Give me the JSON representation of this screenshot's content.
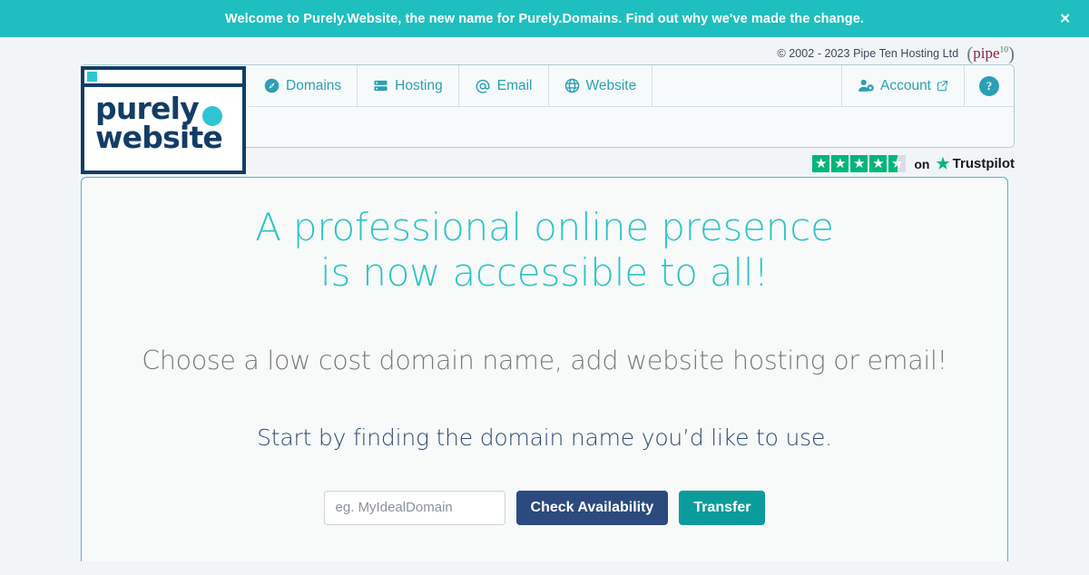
{
  "banner": {
    "message": "Welcome to Purely.Website, the new name for Purely.Domains. Find out why we've made the change.",
    "close_label": "✕",
    "bg_color": "#1fbfbf"
  },
  "copyright": {
    "text": "© 2002 - 2023 Pipe Ten Hosting Ltd",
    "logo_open_paren": "(",
    "logo_word": "pipe",
    "logo_superscript": "10",
    "logo_close_paren": ")"
  },
  "logo": {
    "line1": "purely",
    "line2": "website",
    "color": "#123d66",
    "accent_color": "#2ec4d4"
  },
  "nav": {
    "items": [
      {
        "label": "Domains",
        "icon": "compass-icon"
      },
      {
        "label": "Hosting",
        "icon": "server-icon"
      },
      {
        "label": "Email",
        "icon": "at-sign-icon"
      },
      {
        "label": "Website",
        "icon": "globe-icon"
      }
    ],
    "account": {
      "label": "Account",
      "icon": "user-gear-icon",
      "external_icon": "external-link-icon"
    },
    "help": {
      "label": "?",
      "icon": "question-mark-icon"
    },
    "link_color": "#2a9fb5"
  },
  "trustpilot": {
    "rating": 4.5,
    "max_stars": 5,
    "full_stars": 4,
    "half_star": true,
    "on_label": "on",
    "brand_name": "Trustpilot",
    "star_color": "#00b67a",
    "empty_color": "#dcdce6"
  },
  "hero": {
    "title_line1": "A professional online presence",
    "title_line2": "is now accessible to all!",
    "title_color": "#2ec4c4",
    "subtitle1": "Choose a low cost domain name, add website hosting or email!",
    "subtitle2": "Start by finding the domain name you’d like to use."
  },
  "search": {
    "input_value": "",
    "placeholder": "eg. MyIdealDomain",
    "check_label": "Check Availability",
    "check_color": "#2b4a7e",
    "transfer_label": "Transfer",
    "transfer_color": "#0c9b9b"
  }
}
